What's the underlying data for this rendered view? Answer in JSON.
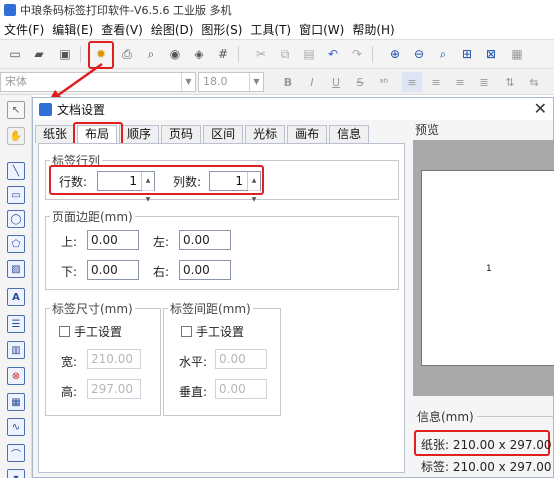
{
  "app": {
    "title": "中琅条码标签打印软件-V6.5.6 工业版 多机"
  },
  "menu": [
    "文件(F)",
    "编辑(E)",
    "查看(V)",
    "绘图(D)",
    "图形(S)",
    "工具(T)",
    "窗口(W)",
    "帮助(H)"
  ],
  "format_toolbar": {
    "font": "宋体",
    "size": "18.0"
  },
  "dialog": {
    "title": "文档设置",
    "tabs": [
      "纸张",
      "布局",
      "顺序",
      "页码",
      "区间",
      "光标",
      "画布",
      "信息"
    ],
    "active_tab": "布局",
    "layout": {
      "rows_cols_title": "标签行列",
      "rows_label": "行数:",
      "rows_value": "1",
      "cols_label": "列数:",
      "cols_value": "1",
      "margin_title": "页面边距(mm)",
      "top_label": "上:",
      "top_value": "0.00",
      "left_label": "左:",
      "left_value": "0.00",
      "bottom_label": "下:",
      "bottom_value": "0.00",
      "right_label": "右:",
      "right_value": "0.00",
      "size_title": "标签尺寸(mm)",
      "size_manual": "手工设置",
      "width_label": "宽:",
      "width_value": "210.00",
      "height_label": "高:",
      "height_value": "297.00",
      "gap_title": "标签间距(mm)",
      "gap_manual": "手工设置",
      "hgap_label": "水平:",
      "hgap_value": "0.00",
      "vgap_label": "垂直:",
      "vgap_value": "0.00"
    },
    "preview": {
      "label": "预览",
      "page_number": "1"
    },
    "info": {
      "title": "信息(mm)",
      "paper": "纸张: 210.00 x 297.00",
      "label": "标签: 210.00 x 297.00"
    }
  }
}
